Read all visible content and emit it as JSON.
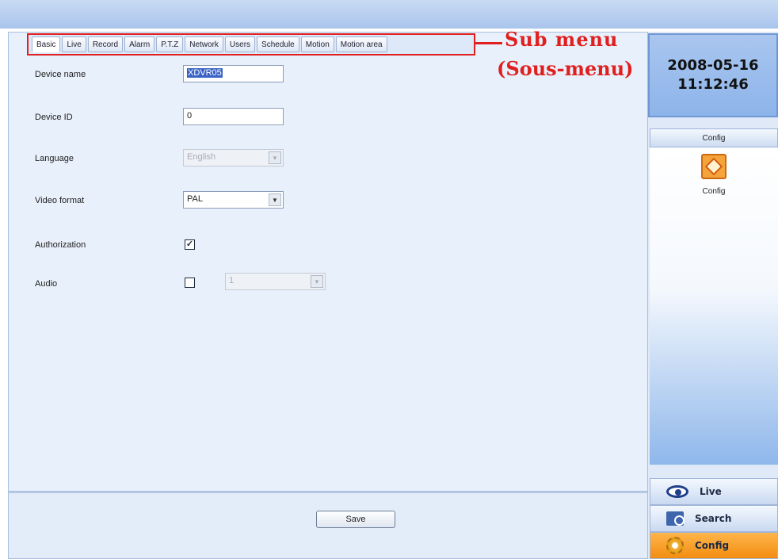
{
  "tabs": [
    "Basic",
    "Live",
    "Record",
    "Alarm",
    "P.T.Z",
    "Network",
    "Users",
    "Schedule",
    "Motion",
    "Motion area"
  ],
  "annotation": {
    "line1": "Sub  menu",
    "line2": "(Sous-menu)"
  },
  "form": {
    "device_name_label": "Device name",
    "device_name_value": "XDVR05",
    "device_id_label": "Device ID",
    "device_id_value": "0",
    "language_label": "Language",
    "language_value": "English",
    "video_format_label": "Video format",
    "video_format_value": "PAL",
    "authorization_label": "Authorization",
    "authorization_checked": true,
    "audio_label": "Audio",
    "audio_checked": false,
    "audio_channel_value": "1"
  },
  "save_label": "Save",
  "clock": {
    "date": "2008-05-16",
    "time": "11:12:46"
  },
  "config_panel": {
    "header": "Config",
    "icon_label": "Config"
  },
  "nav": {
    "live": "Live",
    "search": "Search",
    "config": "Config"
  }
}
